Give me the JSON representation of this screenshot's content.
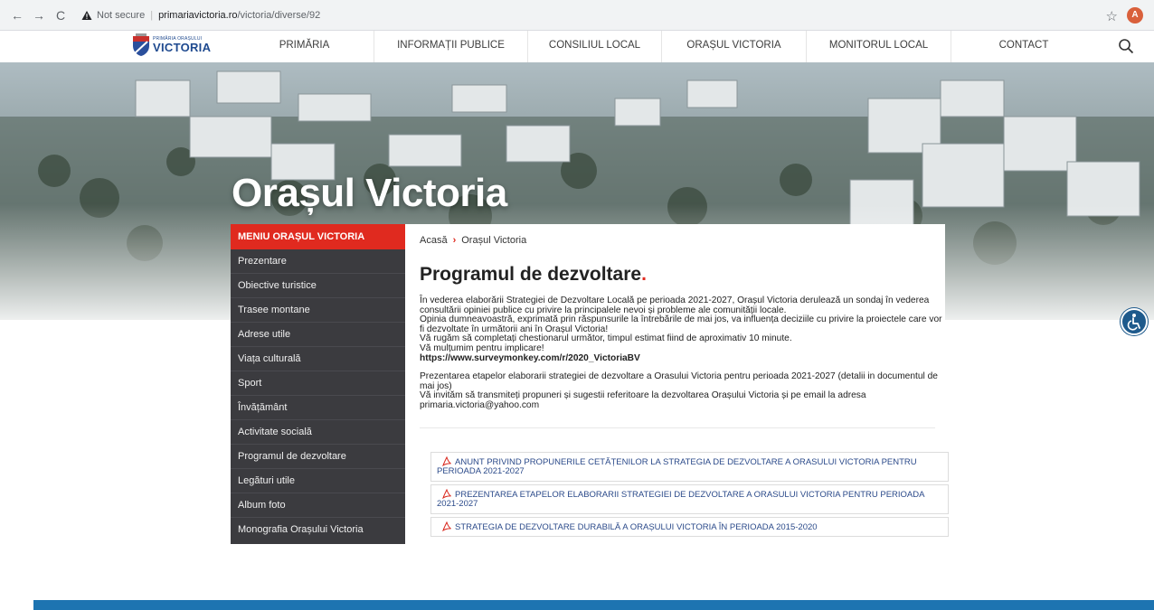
{
  "browser": {
    "nav_back": "←",
    "nav_forward": "→",
    "nav_reload": "C",
    "security": "Not secure",
    "domain": "primariavictoria.ro",
    "path": "/victoria/diverse/92",
    "profile_initial": "A"
  },
  "header": {
    "logo_small": "PRIMĂRIA ORAȘULUI",
    "logo_big": "VICTORIA",
    "nav": [
      "PRIMĂRIA",
      "INFORMAȚII PUBLICE",
      "CONSILIUL LOCAL",
      "ORAȘUL VICTORIA",
      "MONITORUL LOCAL",
      "CONTACT"
    ]
  },
  "hero": {
    "title": "Orașul Victoria"
  },
  "sidebar": {
    "header": "MENIU ORAȘUL VICTORIA",
    "items": [
      "Prezentare",
      "Obiective turistice",
      "Trasee montane",
      "Adrese utile",
      "Viața culturală",
      "Sport",
      "Învățământ",
      "Activitate socială",
      "Programul de dezvoltare",
      "Legături utile",
      "Album foto",
      "Monografia Orașului Victoria"
    ]
  },
  "breadcrumb": {
    "home": "Acasă",
    "sep": "›",
    "current": "Orașul Victoria"
  },
  "main": {
    "title": "Programul de dezvoltare",
    "title_dot": ".",
    "paragraphs": [
      "În vederea elaborării Strategiei de Dezvoltare Locală pe perioada 2021-2027, Orașul Victoria derulează un sondaj în vederea consultării opiniei publice cu privire la principalele nevoi și probleme ale comunității locale.",
      "Opinia dumneavoastră, exprimată prin răspunsurile la întrebările de mai jos, va influența deciziile cu privire la proiectele care vor fi dezvoltate în următorii ani în Orașul Victoria!",
      "Vă rugăm să completați chestionarul următor, timpul estimat fiind de aproximativ 10 minute.",
      "Vă mulțumim pentru implicare!"
    ],
    "survey_link": "https://www.surveymonkey.com/r/2020_VictoriaBV",
    "paragraphs2": [
      "Prezentarea etapelor elaborarii strategiei de dezvoltare a Orasului Victoria pentru perioada 2021-2027 (detalii in documentul de mai jos)",
      "Vă invităm să transmiteți propuneri și sugestii referitoare la dezvoltarea Orașului Victoria și pe email la adresa primaria.victoria@yahoo.com"
    ],
    "documents": [
      "ANUNT PRIVIND PROPUNERILE CETĂȚENILOR LA STRATEGIA DE DEZVOLTARE A ORASULUI VICTORIA PENTRU PERIOADA 2021-2027",
      "PREZENTAREA ETAPELOR ELABORARII STRATEGIEI DE DEZVOLTARE A ORASULUI VICTORIA PENTRU PERIOADA 2021-2027",
      "STRATEGIA DE DEZVOLTARE DURABILĂ A ORAȘULUI VICTORIA ÎN PERIOADA 2015-2020"
    ]
  },
  "colors": {
    "accent_red": "#e02a1f",
    "menu_bg": "#3b3b3f",
    "footer_blue": "#1d74b1",
    "link_blue": "#2b4a8a"
  }
}
